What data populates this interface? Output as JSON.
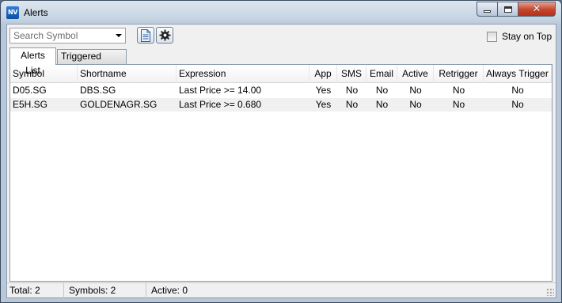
{
  "window": {
    "title": "Alerts",
    "app_icon_text": "NV"
  },
  "toolbar": {
    "search_placeholder": "Search Symbol",
    "stay_on_top_label": "Stay on Top",
    "stay_on_top_checked": false
  },
  "tabs": [
    {
      "label": "Alerts List",
      "active": true
    },
    {
      "label": "Triggered Alerts",
      "active": false
    }
  ],
  "table": {
    "columns": [
      "Symbol",
      "Shortname",
      "Expression",
      "App",
      "SMS",
      "Email",
      "Active",
      "Retrigger",
      "Always Trigger"
    ],
    "rows": [
      [
        "D05.SG",
        "DBS.SG",
        "Last Price >= 14.00",
        "Yes",
        "No",
        "No",
        "No",
        "No",
        "No"
      ],
      [
        "E5H.SG",
        "GOLDENAGR.SG",
        "Last Price >= 0.680",
        "Yes",
        "No",
        "No",
        "No",
        "No",
        "No"
      ]
    ]
  },
  "status": {
    "total": "Total: 2",
    "symbols": "Symbols: 2",
    "active": "Active: 0"
  }
}
